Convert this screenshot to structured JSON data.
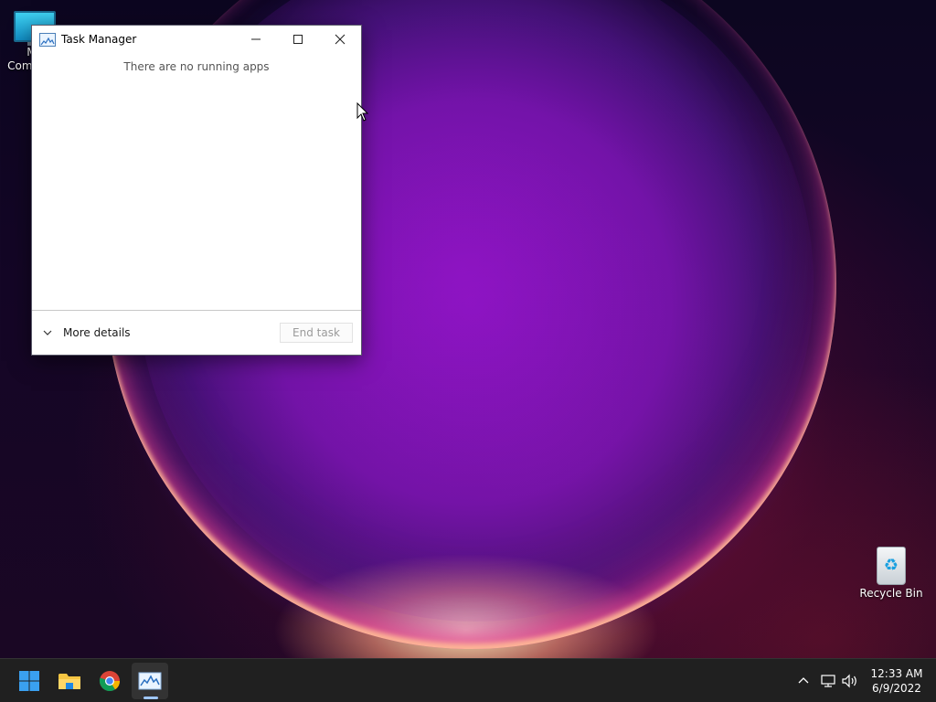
{
  "desktop": {
    "icons": [
      {
        "label": "My Computer",
        "icon": "computer-icon"
      },
      {
        "label": "Recycle Bin",
        "icon": "recycle-bin-icon"
      }
    ]
  },
  "task_manager": {
    "title": "Task Manager",
    "empty_message": "There are no running apps",
    "more_details_label": "More details",
    "end_task_label": "End task",
    "end_task_enabled": false
  },
  "taskbar": {
    "pinned": [
      {
        "name": "start",
        "icon": "windows-logo-icon"
      },
      {
        "name": "file-explorer",
        "icon": "folder-icon"
      },
      {
        "name": "chrome",
        "icon": "chrome-icon"
      },
      {
        "name": "task-manager",
        "icon": "task-manager-icon",
        "active": true
      }
    ],
    "tray": {
      "icons": [
        "chevron-up-icon",
        "network-icon",
        "volume-icon"
      ],
      "time": "12:33 AM",
      "date": "6/9/2022"
    }
  },
  "colors": {
    "taskbar_bg": "#202020",
    "accent": "#0078d4",
    "wallpaper_ring": "#ff5a9a"
  }
}
